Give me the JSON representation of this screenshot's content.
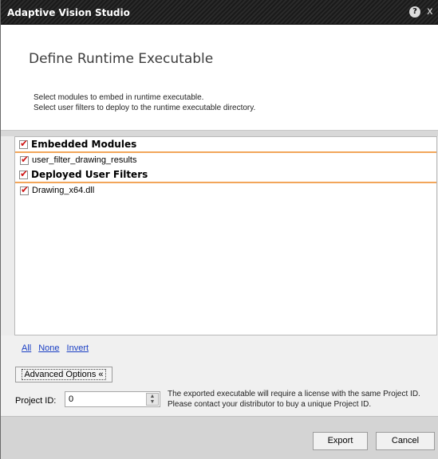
{
  "window": {
    "title": "Adaptive Vision Studio",
    "help_glyph": "?",
    "close_glyph": "x"
  },
  "header": {
    "heading": "Define Runtime Executable",
    "description_line1": "Select modules to embed in runtime executable.",
    "description_line2": "Select user filters to deploy to the runtime executable directory."
  },
  "list": {
    "sections": [
      {
        "label": "Embedded Modules",
        "checked": true,
        "items": [
          {
            "label": "user_filter_drawing_results",
            "checked": true
          }
        ]
      },
      {
        "label": "Deployed User Filters",
        "checked": true,
        "items": [
          {
            "label": "Drawing_x64.dll",
            "checked": true
          }
        ]
      }
    ],
    "check_glyph": "✔"
  },
  "selection_links": {
    "all": "All",
    "none": "None",
    "invert": "Invert"
  },
  "advanced_options_label": "Advanced Options «",
  "project_id": {
    "label": "Project ID:",
    "value": "0",
    "note_line1": "The exported executable will require a license with the same Project ID.",
    "note_line2": "Please contact your distributor to buy a unique Project ID."
  },
  "buttons": {
    "export": "Export",
    "cancel": "Cancel"
  },
  "colors": {
    "section_underline": "#f2a65a",
    "checkmark": "#d01818",
    "link": "#1a3fc4"
  }
}
